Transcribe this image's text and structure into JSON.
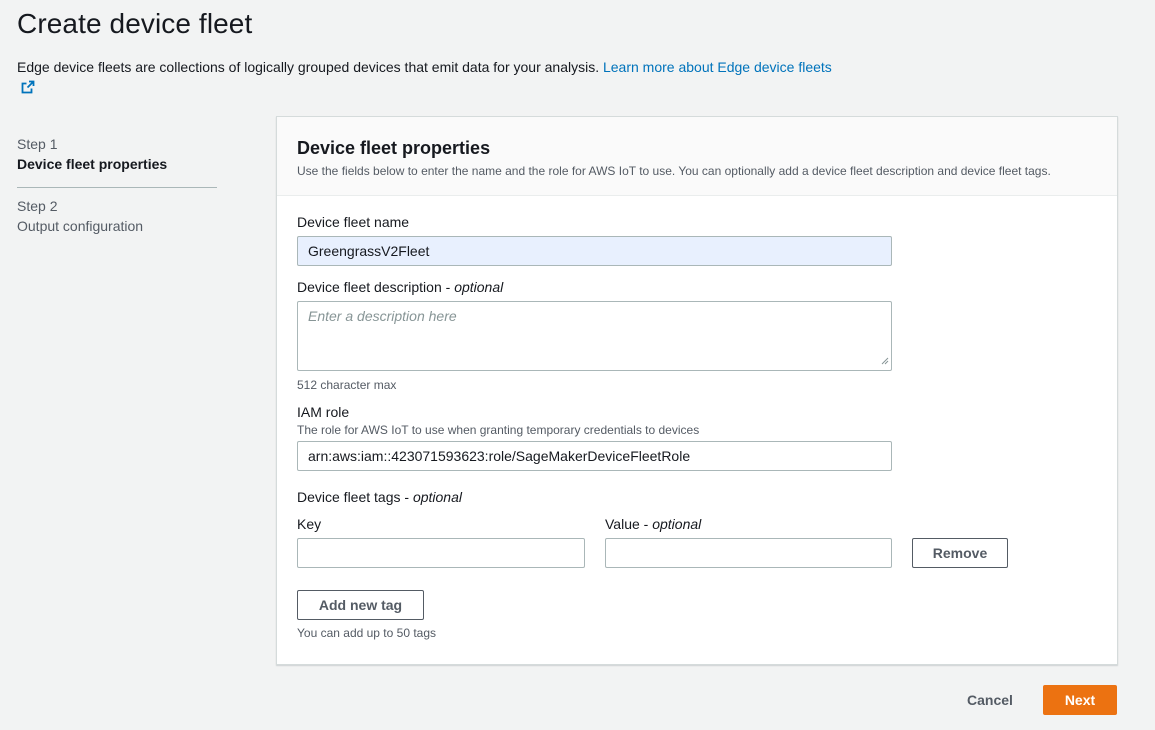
{
  "page": {
    "title": "Create device fleet",
    "intro_text": "Edge device fleets are collections of logically grouped devices that emit data for your analysis. ",
    "learn_more_link": "Learn more about Edge device fleets"
  },
  "steps": [
    {
      "number": "Step 1",
      "name": "Device fleet properties",
      "active": true
    },
    {
      "number": "Step 2",
      "name": "Output configuration",
      "active": false
    }
  ],
  "panel": {
    "title": "Device fleet properties",
    "description": "Use the fields below to enter the name and the role for AWS IoT to use. You can optionally add a device fleet description and device fleet tags."
  },
  "form": {
    "fleet_name": {
      "label": "Device fleet name",
      "value": "GreengrassV2Fleet"
    },
    "description": {
      "label": "Device fleet description - ",
      "label_optional": "optional",
      "placeholder": "Enter a description here",
      "hint": "512 character max"
    },
    "iam_role": {
      "label": "IAM role",
      "hint": "The role for AWS IoT to use when granting temporary credentials to devices",
      "value": "arn:aws:iam::423071593623:role/SageMakerDeviceFleetRole"
    },
    "tags": {
      "label": "Device fleet tags - ",
      "label_optional": "optional",
      "key_label": "Key",
      "value_label": "Value - ",
      "value_label_optional": "optional",
      "key_value": "",
      "value_value": "",
      "remove_label": "Remove",
      "add_label": "Add new tag",
      "hint": "You can add up to 50 tags"
    }
  },
  "footer": {
    "cancel_label": "Cancel",
    "next_label": "Next"
  },
  "colors": {
    "link": "#0073bb",
    "primary_button": "#ec7211",
    "background": "#f2f3f3",
    "autofill": "#e8f0fe"
  },
  "icons": {
    "external_link": "external-link-icon"
  }
}
